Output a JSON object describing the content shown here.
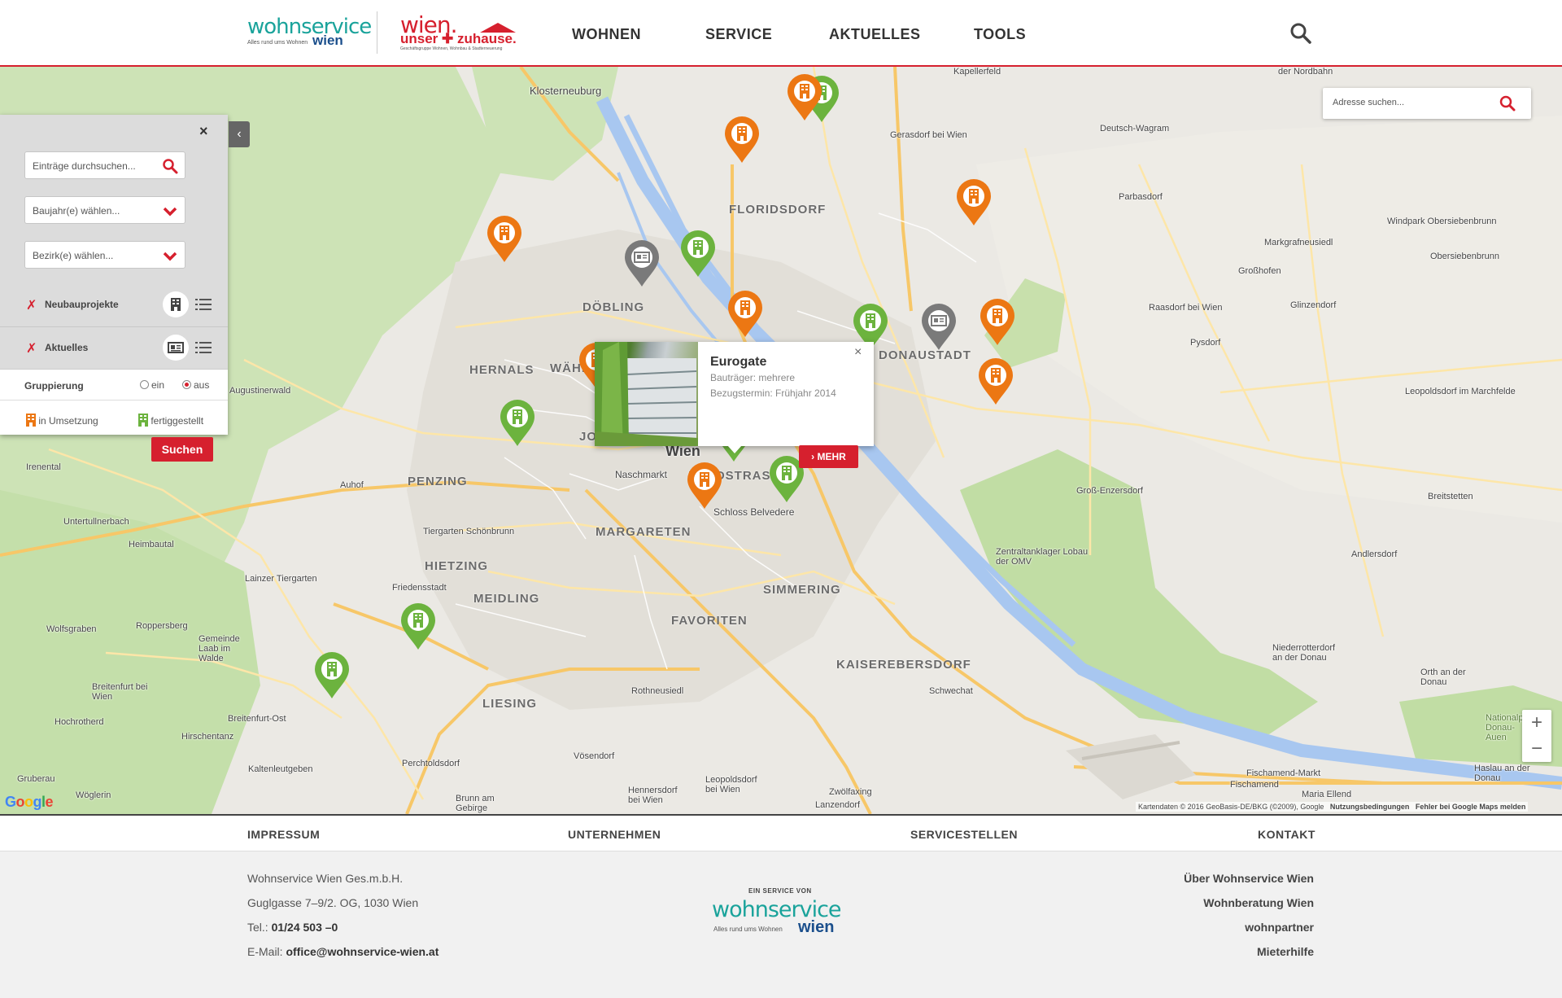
{
  "header": {
    "logo_wohnservice": "wohnservice",
    "logo_wohnservice_sub": "Alles rund ums Wohnen",
    "logo_wohnservice_wien": "wien",
    "logo_wien": "wien.",
    "logo_wien_sub": "unser ✚ zuhause.",
    "logo_wien_small": "Geschäftsgruppe Wohnen, Wohnbau & Stadterneuerung",
    "nav": [
      "WOHNEN",
      "SERVICE",
      "AKTUELLES",
      "TOOLS"
    ]
  },
  "map": {
    "address_search_placeholder": "Adresse suchen...",
    "panel": {
      "search_placeholder": "Einträge durchsuchen...",
      "year_select": "Baujahr(e) wählen...",
      "district_select": "Bezirk(e) wählen...",
      "layer1_label": "Neubauprojekte",
      "layer2_label": "Aktuelles",
      "check_mark": "✗",
      "grouping_label": "Gruppierung",
      "grouping_on": "ein",
      "grouping_off": "aus",
      "legend_in_progress": "in Umsetzung",
      "legend_done": "fertiggestellt",
      "search_button": "Suchen",
      "close": "×"
    },
    "popup": {
      "title": "Eurogate",
      "line1": "Bauträger: mehrere",
      "line2": "Bezugstermin: Frühjahr 2014",
      "close": "×",
      "more_button": "MEHR"
    },
    "districts": [
      "FLORIDSDORF",
      "DÖBLING",
      "HERNALS",
      "WÄHRI",
      "PENZING",
      "LANDSTRASSE",
      "MARGARETEN",
      "HIETZING",
      "MEIDLING",
      "FAVORITEN",
      "SIMMERING",
      "LIESING",
      "KAISEREBERSDORF",
      "DONAUSTADT",
      "JO"
    ],
    "places": [
      "Klosterneuburg",
      "Kapellerfeld",
      "der Nordbahn",
      "Gerasdorf bei Wien",
      "Deutsch-Wagram",
      "Parbasdorf",
      "Windpark Obersiebenbrunn",
      "Markgrafneusiedl",
      "Obersiebenbrunn",
      "Großhofen",
      "Glinzendorf",
      "Raasdorf bei Wien",
      "Pysdorf",
      "Leopoldsdorf im Marchfelde",
      "Augustinerwald",
      "Irenental",
      "Auhof",
      "Untertullnerbach",
      "Tiergarten Schönbrunn",
      "Heimbautal",
      "Lainzer Tiergarten",
      "Friedensstadt",
      "Wolfsgraben",
      "Roppersberg",
      "Gemeinde Laab im Walde",
      "Breitenfurt bei Wien",
      "Hochrotherd",
      "Breitenfurt-Ost",
      "Hirschentanz",
      "Kaltenleutgeben",
      "Gruberau",
      "Wöglerin",
      "Perchtoldsdorf",
      "Vösendorf",
      "Rothneusiedl",
      "Hennersdorf bei Wien",
      "Leopoldsdorf bei Wien",
      "Zwölfaxing",
      "Lanzendorf",
      "Schwechat",
      "Brunn am Gebirge",
      "Wien",
      "Naschmarkt",
      "Schloss Belvedere",
      "Groß-Enzersdorf",
      "Zentraltanklager Lobau der OMV",
      "Breitstetten",
      "Andlersdorf",
      "Orth an der Donau",
      "Niederrotterdorf an der Donau",
      "Fischamend-Markt",
      "Fischamend",
      "Maria Ellend",
      "Haslau an der Donau",
      "Nationalpark Donau-Auen"
    ],
    "zoom_in": "+",
    "zoom_out": "−",
    "google": "Google",
    "attribution": "Kartendaten © 2016 GeoBasis-DE/BKG (©2009), Google",
    "terms": "Nutzungsbedingungen",
    "report": "Fehler bei Google Maps melden",
    "colors": {
      "orange": "#ec7713",
      "green": "#6cb33e",
      "gray": "#7a7a7a",
      "red": "#d6202e"
    }
  },
  "footer_nav": [
    "IMPRESSUM",
    "UNTERNEHMEN",
    "SERVICESTELLEN",
    "KONTAKT"
  ],
  "footer": {
    "company": "Wohnservice Wien Ges.m.b.H.",
    "address": "Guglgasse 7–9/2. OG, 1030 Wien",
    "tel_label": "Tel.:",
    "tel": "01/24 503 –0",
    "email_label": "E-Mail:",
    "email": "office@wohnservice-wien.at",
    "service_of": "EIN SERVICE VON",
    "links": [
      "Über Wohnservice Wien",
      "Wohnberatung Wien",
      "wohnpartner",
      "Mieterhilfe"
    ]
  }
}
